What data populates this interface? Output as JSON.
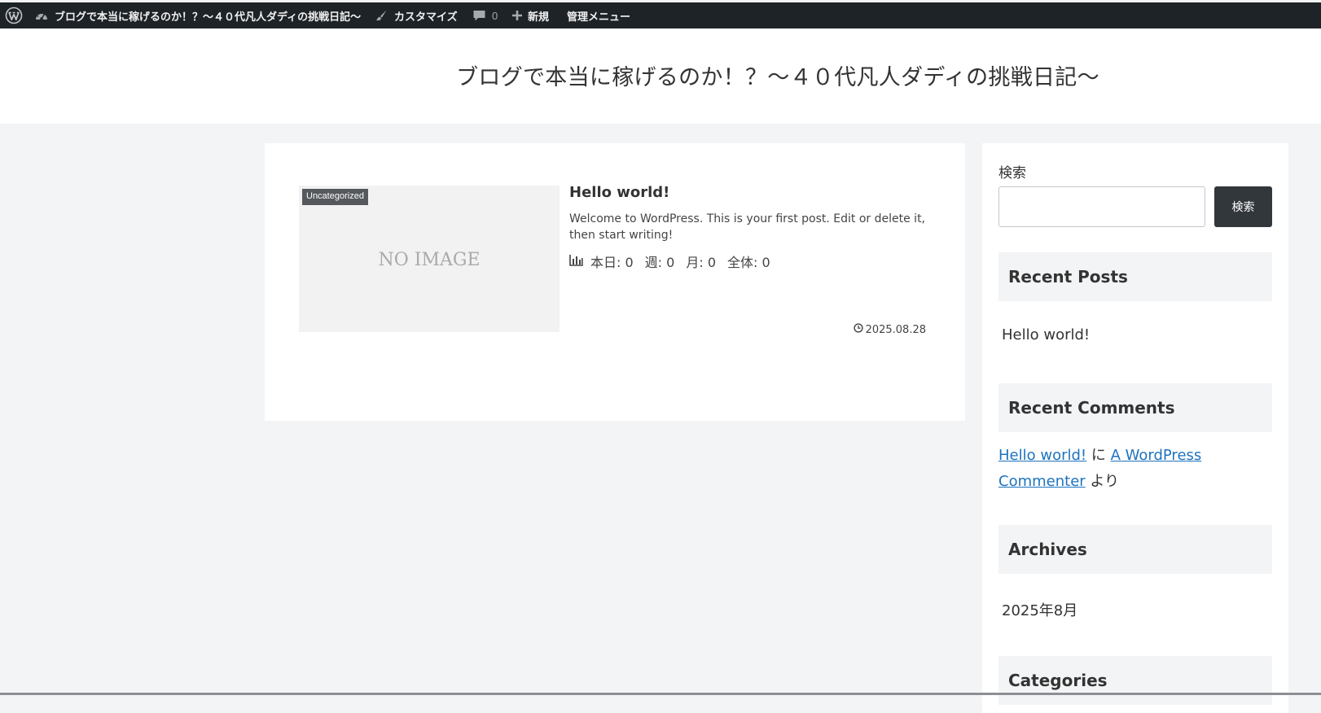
{
  "admin_bar": {
    "site_name": "ブログで本当に稼げるのか！？～４０代凡人ダディの挑戦日記～",
    "customize": "カスタマイズ",
    "comments_count": "0",
    "new": "新規",
    "admin_menu": "管理メニュー"
  },
  "header": {
    "site_title": "ブログで本当に稼げるのか！？～４０代凡人ダディの挑戦日記～"
  },
  "post": {
    "category": "Uncategorized",
    "thumbnail_text": "NO IMAGE",
    "title": "Hello world!",
    "excerpt": "Welcome to WordPress. This is your first post. Edit or delete it, then start writing!",
    "stats": {
      "today": "本日: 0",
      "week": "週: 0",
      "month": "月: 0",
      "total": "全体: 0"
    },
    "date": "2025.08.28"
  },
  "sidebar": {
    "search_label": "検索",
    "search_value": "",
    "search_button": "検索",
    "recent_posts": {
      "heading": "Recent Posts",
      "items": [
        "Hello world!"
      ]
    },
    "recent_comments": {
      "heading": "Recent Comments",
      "post_link": "Hello world!",
      "ni": "に",
      "author_link": "A WordPress Commenter",
      "yori": "より"
    },
    "archives": {
      "heading": "Archives",
      "items": [
        "2025年8月"
      ]
    },
    "categories": {
      "heading": "Categories"
    }
  },
  "colors": {
    "admin_bar_bg": "#1d2327",
    "page_bg": "#f3f4f6",
    "link": "#1e73be",
    "button_bg": "#32373c"
  }
}
